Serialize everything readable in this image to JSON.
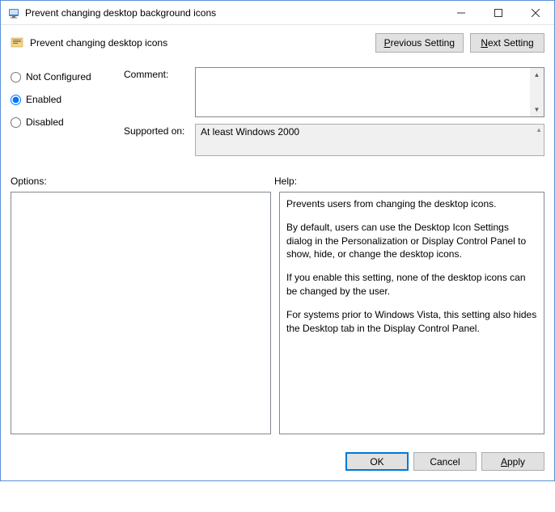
{
  "window": {
    "title": "Prevent changing desktop background icons"
  },
  "header": {
    "policy_title": "Prevent changing desktop icons",
    "prev_btn": {
      "prefix": "P",
      "rest": "revious Setting"
    },
    "next_btn": {
      "prefix": "N",
      "rest": "ext Setting"
    }
  },
  "radio": {
    "not_configured": "Not Configured",
    "enabled": "Enabled",
    "disabled": "Disabled",
    "selected": "enabled"
  },
  "fields": {
    "comment_label": "Comment:",
    "comment_value": "",
    "supported_label": "Supported on:",
    "supported_value": "At least Windows 2000"
  },
  "sections": {
    "options_label": "Options:",
    "help_label": "Help:"
  },
  "help": {
    "p1": "Prevents users from changing the desktop icons.",
    "p2": "By default, users can use the Desktop Icon Settings dialog in the Personalization or Display Control Panel to show, hide, or change the desktop icons.",
    "p3": "If you enable this setting, none of the desktop icons can be changed by the user.",
    "p4": "For systems prior to Windows Vista, this setting also hides the Desktop tab in the Display Control Panel."
  },
  "footer": {
    "ok": "OK",
    "cancel": "Cancel",
    "apply": {
      "prefix": "A",
      "rest": "pply"
    }
  }
}
